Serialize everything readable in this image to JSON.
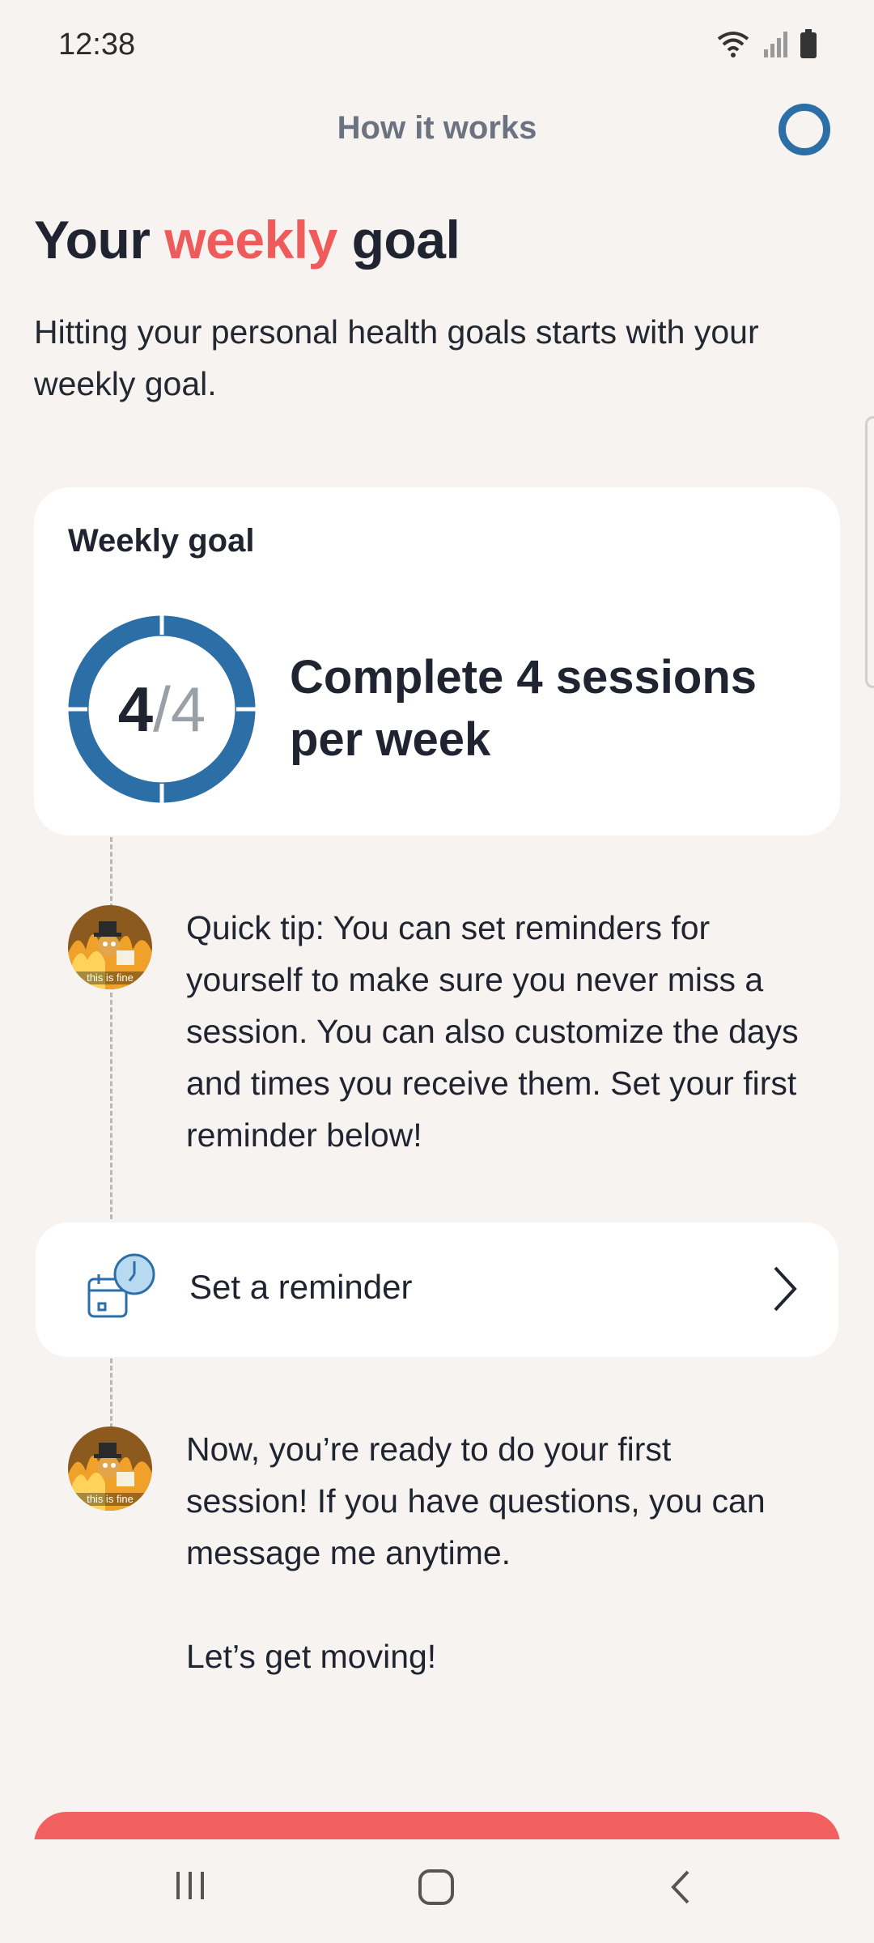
{
  "status_bar": {
    "time": "12:38",
    "icons": [
      "wifi-icon",
      "signal-icon",
      "battery-icon"
    ]
  },
  "header": {
    "title": "How it works",
    "progress_icon": "progress-ring-icon"
  },
  "heading": {
    "part1": "Your ",
    "accent": "weekly",
    "part2": " goal"
  },
  "intro": "Hitting your personal health goals starts with your weekly goal.",
  "goal_card": {
    "title": "Weekly goal",
    "completed": "4",
    "separator": "/",
    "target": "4",
    "progress": 1.0,
    "description": "Complete 4 sessions per week"
  },
  "tips": [
    {
      "avatar_caption": "this is fine",
      "text": "Quick tip: You can set reminders for yourself to make sure you never miss a session. You can also customize the days and times you receive them. Set your first reminder below!"
    },
    {
      "avatar_caption": "this is fine",
      "text": "Now, you’re ready to do your first session! If you have questions, you can message me anytime.",
      "text2": "Let’s get moving!"
    }
  ],
  "reminder": {
    "label": "Set a reminder",
    "icon": "calendar-clock-icon"
  },
  "colors": {
    "accent": "#ef5b5b",
    "ring": "#2c6fa6",
    "cta": "#f26060",
    "background": "#f6f3f1"
  },
  "nav": [
    "recent-apps-icon",
    "home-icon",
    "back-icon"
  ]
}
